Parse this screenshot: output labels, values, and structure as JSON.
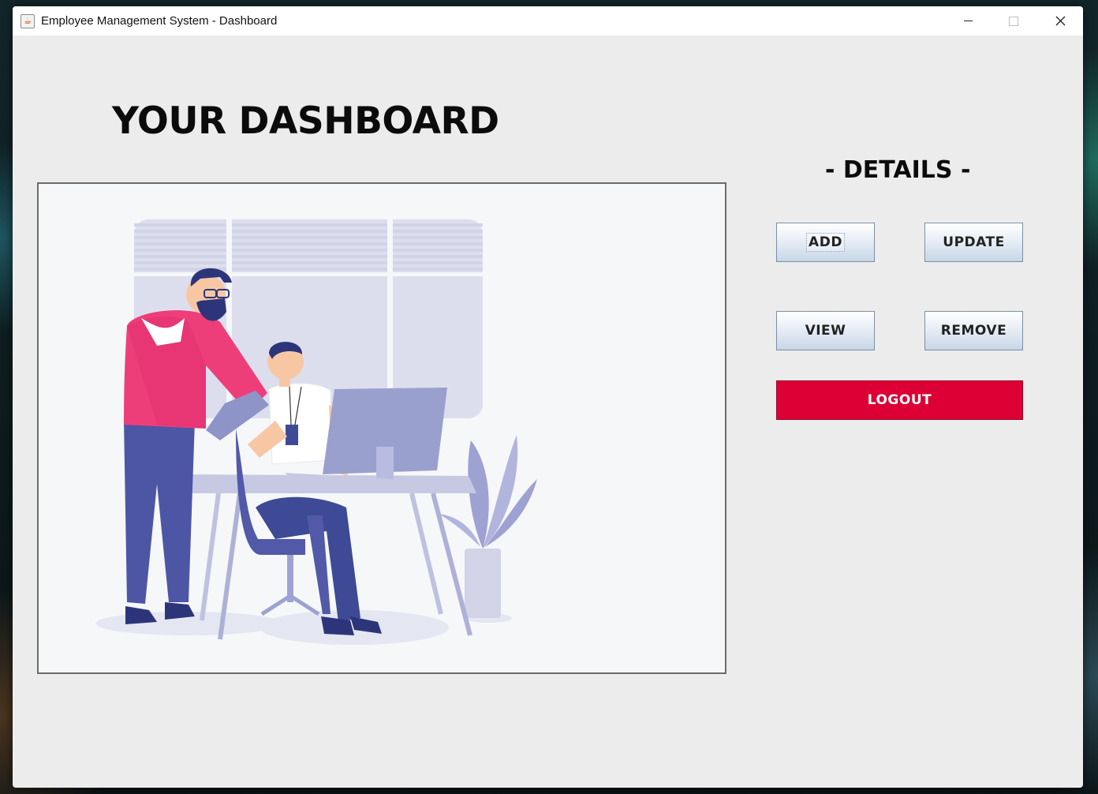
{
  "window": {
    "title": "Employee Management System - Dashboard",
    "minimize_icon": "minimize-icon",
    "maximize_icon": "maximize-icon",
    "close_icon": "close-icon"
  },
  "main": {
    "heading": "YOUR DASHBOARD",
    "illustration": "office-workers-illustration"
  },
  "details": {
    "title": "- DETAILS -",
    "buttons": {
      "add": "ADD",
      "update": "UPDATE",
      "view": "VIEW",
      "remove": "REMOVE",
      "logout": "LOGOUT"
    }
  },
  "colors": {
    "logout_bg": "#dc0034",
    "window_bg": "#ececec"
  }
}
